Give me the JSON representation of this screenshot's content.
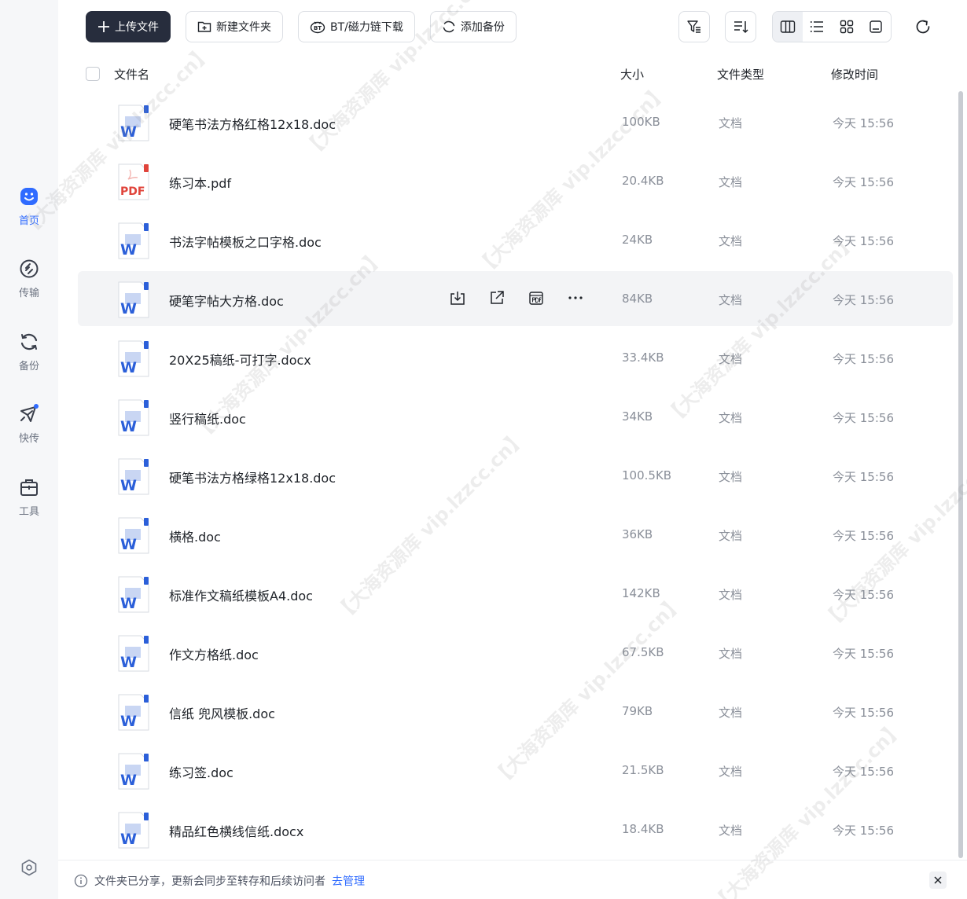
{
  "toolbar": {
    "upload": "上传文件",
    "new_folder": "新建文件夹",
    "bt_download": "BT/磁力链下载",
    "add_backup": "添加备份"
  },
  "sidebar": {
    "items": [
      {
        "label": "首页",
        "icon": "home-face-icon",
        "active": true
      },
      {
        "label": "传输",
        "icon": "transfer-icon",
        "active": false
      },
      {
        "label": "备份",
        "icon": "backup-icon",
        "active": false
      },
      {
        "label": "快传",
        "icon": "quick-send-icon",
        "active": false
      },
      {
        "label": "工具",
        "icon": "toolbox-icon",
        "active": false
      }
    ]
  },
  "columns": {
    "name": "文件名",
    "size": "大小",
    "type": "文件类型",
    "modified": "修改时间"
  },
  "files": [
    {
      "name": "硬笔书法方格红格12x18.doc",
      "size": "100KB",
      "type": "文档",
      "modified": "今天 15:56",
      "kind": "word"
    },
    {
      "name": "练习本.pdf",
      "size": "20.4KB",
      "type": "文档",
      "modified": "今天 15:56",
      "kind": "pdf"
    },
    {
      "name": "书法字帖模板之口字格.doc",
      "size": "24KB",
      "type": "文档",
      "modified": "今天 15:56",
      "kind": "word"
    },
    {
      "name": "硬笔字帖大方格.doc",
      "size": "84KB",
      "type": "文档",
      "modified": "今天 15:56",
      "kind": "word"
    },
    {
      "name": "20X25稿纸-可打字.docx",
      "size": "33.4KB",
      "type": "文档",
      "modified": "今天 15:56",
      "kind": "word"
    },
    {
      "name": "竖行稿纸.doc",
      "size": "34KB",
      "type": "文档",
      "modified": "今天 15:56",
      "kind": "word"
    },
    {
      "name": "硬笔书法方格绿格12x18.doc",
      "size": "100.5KB",
      "type": "文档",
      "modified": "今天 15:56",
      "kind": "word"
    },
    {
      "name": "横格.doc",
      "size": "36KB",
      "type": "文档",
      "modified": "今天 15:56",
      "kind": "word"
    },
    {
      "name": "标准作文稿纸模板A4.doc",
      "size": "142KB",
      "type": "文档",
      "modified": "今天 15:56",
      "kind": "word"
    },
    {
      "name": "作文方格纸.doc",
      "size": "67.5KB",
      "type": "文档",
      "modified": "今天 15:56",
      "kind": "word"
    },
    {
      "name": "信纸 兜风模板.doc",
      "size": "79KB",
      "type": "文档",
      "modified": "今天 15:56",
      "kind": "word"
    },
    {
      "name": "练习签.doc",
      "size": "21.5KB",
      "type": "文档",
      "modified": "今天 15:56",
      "kind": "word"
    },
    {
      "name": "精品红色横线信纸.docx",
      "size": "18.4KB",
      "type": "文档",
      "modified": "今天 15:56",
      "kind": "word"
    }
  ],
  "file_icons": {
    "word_letter": "W",
    "pdf_label": "PDF"
  },
  "footer": {
    "message": "文件夹已分享，更新会同步至转存和后续访问者",
    "link": "去管理"
  },
  "watermark": "【大海资源库 vip.lzzcc.cn】",
  "colors": {
    "primary_button": "#272d3d",
    "accent": "#2f6bff",
    "hover_row": "#f3f4f6",
    "sidebar_bg": "#f6f7f9"
  }
}
